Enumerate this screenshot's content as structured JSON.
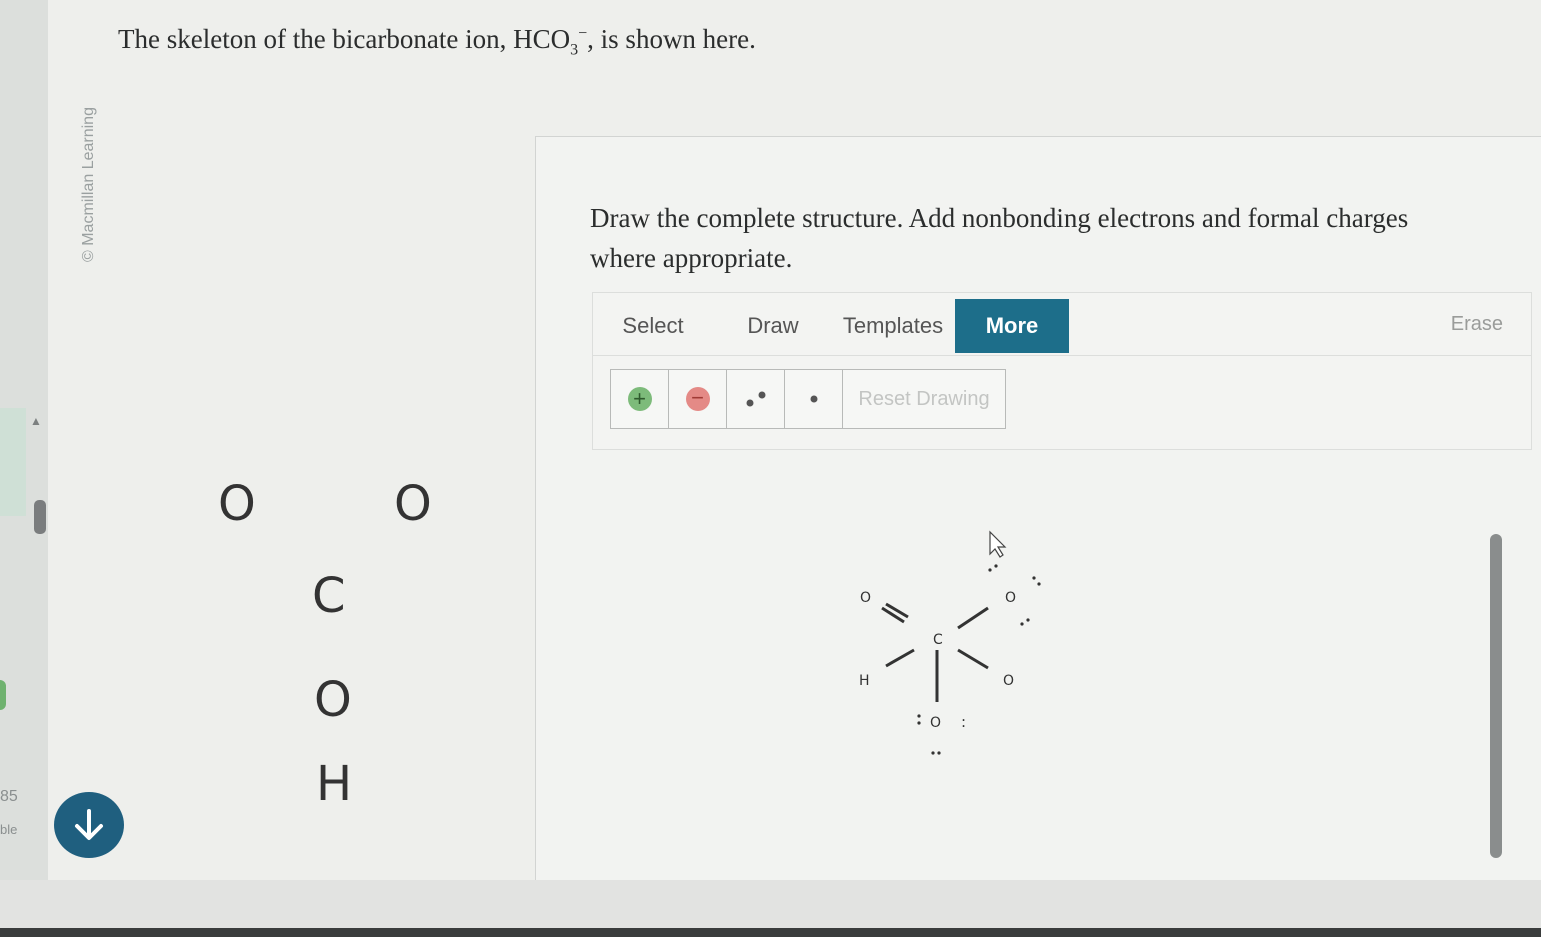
{
  "credit": "© Macmillan Learning",
  "question": {
    "prefix": "The skeleton of the bicarbonate ion, ",
    "formula_base": "HCO",
    "formula_sub": "3",
    "formula_sup": "−",
    "suffix": ", is shown here."
  },
  "skeleton": {
    "o_left": "O",
    "o_right": "O",
    "c": "C",
    "o_mid": "O",
    "h": "H"
  },
  "instructions": "Draw the complete structure. Add nonbonding electrons and formal charges where appropriate.",
  "toolbar": {
    "tabs": [
      {
        "label": "Select",
        "active": false
      },
      {
        "label": "Draw",
        "active": false
      },
      {
        "label": "Templates",
        "active": false
      },
      {
        "label": "More",
        "active": true
      }
    ],
    "erase": "Erase",
    "tools": {
      "add_charge": "add-charge",
      "remove_charge": "remove-charge",
      "lone_pair": "lone-pair",
      "radical": "radical",
      "reset": "Reset Drawing"
    }
  },
  "drawing": {
    "o_top_left": "O",
    "o_top_right": "O",
    "c": "C",
    "h": "H",
    "o_right": "O",
    "o_bottom": "O",
    "lone_colon": ":"
  },
  "left_rail": {
    "text1": "85",
    "text2": "ble"
  },
  "colors": {
    "accent": "#1d6e8a",
    "plus": "#7dbb7a",
    "minus": "#e48a86"
  }
}
